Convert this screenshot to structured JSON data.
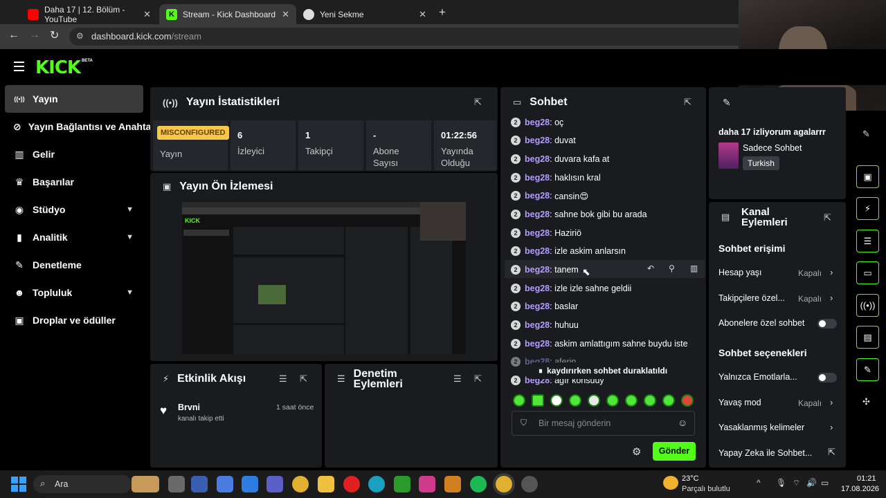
{
  "browser": {
    "tabs": [
      {
        "title": "Daha 17 | 12. Bölüm - YouTube",
        "close": "✕"
      },
      {
        "title": "Stream - Kick Dashboard",
        "close": "✕"
      },
      {
        "title": "Yeni Sekme",
        "close": "✕"
      }
    ],
    "new_tab": "+",
    "url_domain": "dashboard.kick.com",
    "url_path": "/stream"
  },
  "header": {
    "logo": "KICK",
    "logo_badge": "BETA"
  },
  "sidebar": {
    "items": [
      {
        "label": "Yayın",
        "icon": "broadcast-icon",
        "glyph": "((•))",
        "active": true
      },
      {
        "label": "Yayın Bağlantısı ve Anahtarı",
        "icon": "link-icon",
        "glyph": "⊘"
      },
      {
        "label": "Gelir",
        "icon": "revenue-icon",
        "glyph": "▥"
      },
      {
        "label": "Başarılar",
        "icon": "trophy-icon",
        "glyph": "♛"
      },
      {
        "label": "Stüdyo",
        "icon": "studio-icon",
        "glyph": "◉",
        "chevron": "⌄"
      },
      {
        "label": "Analitik",
        "icon": "analytics-icon",
        "glyph": "▮"
      },
      {
        "label": "Denetleme",
        "icon": "wrench-icon",
        "glyph": "✎"
      },
      {
        "label": "Topluluk",
        "icon": "community-icon",
        "glyph": "☻",
        "chevron": "⌄"
      },
      {
        "label": "Droplar ve ödüller",
        "icon": "gift-icon",
        "glyph": "▣"
      }
    ]
  },
  "stats": {
    "title": "Yayın İstatistikleri",
    "status_badge": "MISCONFIGURED",
    "status_label": "Yayın",
    "viewers": "6",
    "viewers_label": "İzleyici",
    "followers": "1",
    "followers_label": "Takipçi",
    "subs": "-",
    "subs_label": "Abone Sayısı",
    "uptime": "01:22:56",
    "uptime_label": "Yayında Olduğu"
  },
  "preview": {
    "title": "Yayın Ön İzlemesi"
  },
  "activity": {
    "title": "Etkinlik Akışı",
    "items": [
      {
        "user": "Brvni",
        "text": "kanalı takip etti",
        "time": "1 saat önce"
      }
    ]
  },
  "mod": {
    "title": "Denetim Eylemleri"
  },
  "chat": {
    "title": "Sohbet",
    "messages": [
      {
        "badge": "2",
        "user": "beg28",
        "text": "oç"
      },
      {
        "badge": "2",
        "user": "beg28",
        "text": "duvat"
      },
      {
        "badge": "2",
        "user": "beg28",
        "text": "duvara kafa at"
      },
      {
        "badge": "2",
        "user": "beg28",
        "text": "haklısın kral"
      },
      {
        "badge": "2",
        "user": "beg28",
        "text": "cansin😍"
      },
      {
        "badge": "2",
        "user": "beg28",
        "text": "sahne bok gibi bu arada"
      },
      {
        "badge": "2",
        "user": "beg28",
        "text": "Haziriö"
      },
      {
        "badge": "2",
        "user": "beg28",
        "text": "izle askim anlarsın"
      },
      {
        "badge": "2",
        "user": "beg28",
        "text": "tanem"
      },
      {
        "badge": "2",
        "user": "beg28",
        "text": "izle izle sahne geldii"
      },
      {
        "badge": "2",
        "user": "beg28",
        "text": "baslar"
      },
      {
        "badge": "2",
        "user": "beg28",
        "text": "huhuu"
      },
      {
        "badge": "2",
        "user": "beg28",
        "text": "askim amlattıgım sahne buydu iste"
      },
      {
        "badge": "2",
        "user": "beg28",
        "text": "aferin"
      },
      {
        "badge": "2",
        "user": "beg28",
        "text": "agır konsuuy"
      }
    ],
    "paused": "kaydırırken sohbet duraklatıldı",
    "input_placeholder": "Bir mesaj gönderin",
    "send": "Gönder"
  },
  "channel": {
    "stream_title": "daha 17 izliyorum agalarrr",
    "category": "Sadece Sohbet",
    "language": "Turkish",
    "actions_title": "Kanal Eylemleri",
    "access_title": "Sohbet erişimi",
    "account_age": "Hesap yaşı",
    "account_age_val": "Kapalı",
    "followers_only": "Takipçilere özel...",
    "followers_only_val": "Kapalı",
    "subs_only": "Abonelere özel sohbet",
    "options_title": "Sohbet seçenekleri",
    "emotes_only": "Yalnızca Emotlarla...",
    "slow_mode": "Yavaş mod",
    "slow_mode_val": "Kapalı",
    "banned_words": "Yasaklanmış kelimeler",
    "ai_mod": "Yapay Zeka ile Sohbet..."
  },
  "taskbar": {
    "search": "Ara",
    "weather_temp": "23°C",
    "weather_text": "Parçalı bulutlu",
    "time": "01:21",
    "date": "17.08.2026"
  },
  "colors": {
    "accent": "#53fc18",
    "panel": "#191b1f",
    "username": "#b79cff"
  }
}
